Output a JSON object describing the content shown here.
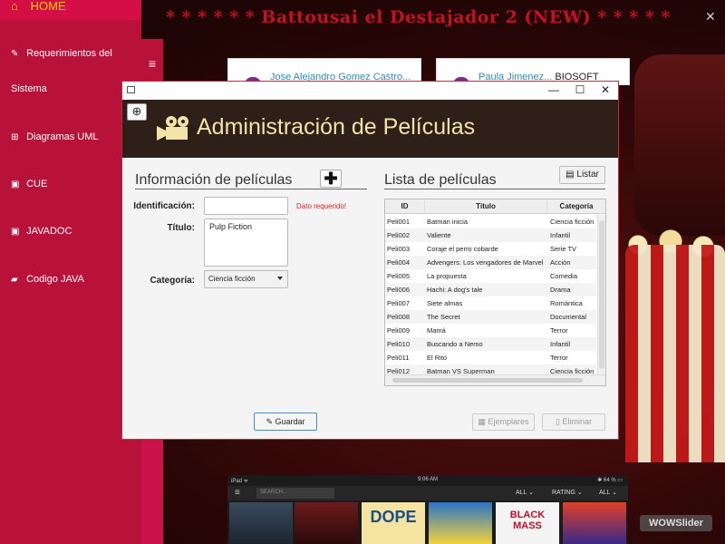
{
  "background": {
    "banner_title": "* * * * * *  Battousai el Destajador 2 (NEW)  * * * * *",
    "close_glyph": "✕",
    "card1_text": "Jose Alejandro Gomez Castro...",
    "card2_text": "Paula Jimenez...",
    "card2_bold": "BIOSOFT",
    "watermark": "WOWSlider"
  },
  "sidebar": {
    "toggle_glyph": "≡",
    "items": [
      {
        "label": "HOME",
        "icon": "home-icon",
        "glyph": "⌂"
      },
      {
        "label": "Requerimientos del",
        "icon": "pin-icon",
        "glyph": "✎"
      },
      {
        "label": "Sistema"
      },
      {
        "label": "Diagramas UML",
        "icon": "sitemap-icon",
        "glyph": "⊞"
      },
      {
        "label": "CUE",
        "icon": "list-icon",
        "glyph": "▣"
      },
      {
        "label": "JAVADOC",
        "icon": "list-icon",
        "glyph": "▣"
      },
      {
        "label": "Codigo JAVA",
        "icon": "file-code-icon",
        "glyph": "▰"
      }
    ]
  },
  "tablet": {
    "status_left": "iPad ᯤ",
    "status_time": "9:06 AM",
    "status_right": "✱ 64 % ▭",
    "search_placeholder": "SEARCH...",
    "filters": [
      "ALL ⌄",
      "RATING ⌄",
      "ALL ⌄"
    ],
    "posters": [
      "",
      "",
      "DOPE",
      "",
      "BLACK MASS",
      ""
    ]
  },
  "window": {
    "title_buttons": {
      "minimize": "—",
      "maximize": "☐",
      "close": "✕"
    },
    "header_title": "Administración de Películas",
    "back_glyph": "⊕",
    "info_section_title": "Información de películas",
    "add_glyph": "✚",
    "list_section_title": "Lista de películas",
    "listar_label": "Listar",
    "listar_icon_glyph": "▤",
    "form": {
      "id_label": "Identificación:",
      "id_value": "",
      "required_msg": "Dato requerido!",
      "title_label": "Título:",
      "title_value": "Pulp Fiction",
      "category_label": "Categoría:",
      "category_value": "Ciencia ficción"
    },
    "table": {
      "headers": [
        "ID",
        "Título",
        "Categoría"
      ],
      "rows": [
        [
          "Peli001",
          "Batman inicia",
          "Ciencia ficción"
        ],
        [
          "Peli002",
          "Valiente",
          "Infantil"
        ],
        [
          "Peli003",
          "Coraje el perro cobarde",
          "Serie TV"
        ],
        [
          "Peli004",
          "Advengers: Los vengadores de Marvel",
          "Acción"
        ],
        [
          "Peli005",
          "La propuesta",
          "Comedia"
        ],
        [
          "Peli006",
          "Hachi: A dog's tale",
          "Drama"
        ],
        [
          "Peli007",
          "Siete almas",
          "Romántica"
        ],
        [
          "Peli008",
          "The Secret",
          "Documental"
        ],
        [
          "Peli009",
          "Mamá",
          "Terror"
        ],
        [
          "Peli010",
          "Buscando a Nemo",
          "Infantil"
        ],
        [
          "Peli011",
          "El Rito",
          "Terror"
        ],
        [
          "Peli012",
          "Batman VS Superman",
          "Ciencia ficción"
        ]
      ]
    },
    "buttons": {
      "guardar": "Guardar",
      "guardar_glyph": "✎",
      "ejemplares": "Ejemplares",
      "ejemplares_glyph": "▦",
      "eliminar": "Eliminar",
      "eliminar_glyph": "▯"
    }
  }
}
